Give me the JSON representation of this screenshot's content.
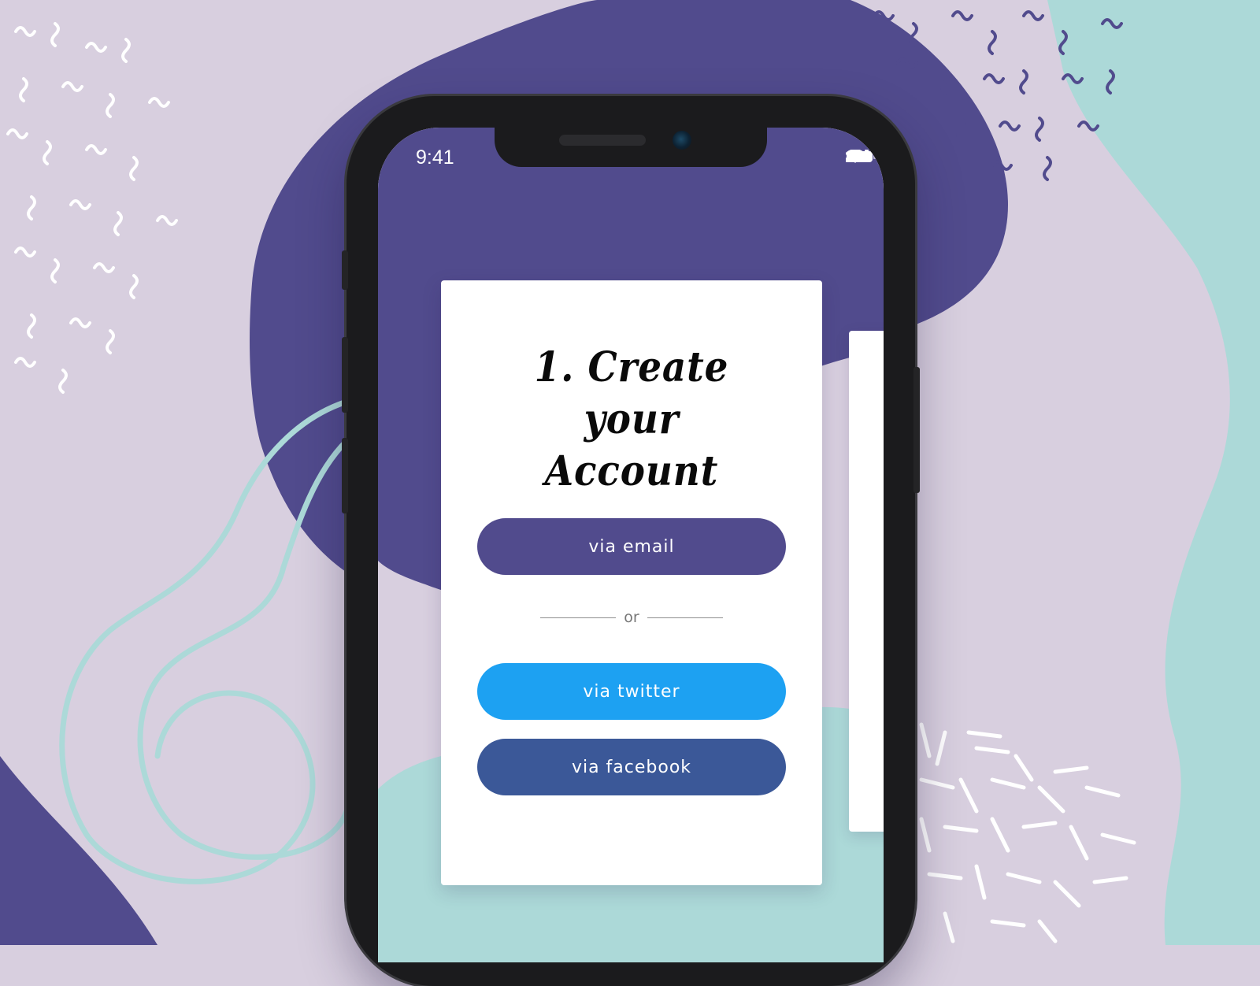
{
  "status_bar": {
    "time": "9:41",
    "icons": [
      "signal-icon",
      "wifi-icon",
      "battery-icon"
    ]
  },
  "card": {
    "title_line1": "1. Create your",
    "title_line2": "Account",
    "email_button": "via email",
    "divider_text": "or",
    "twitter_button": "via twitter",
    "facebook_button": "via facebook"
  },
  "colors": {
    "background": "#d8cfdf",
    "purple_blob": "#514b8d",
    "mint": "#acd9d8",
    "email_button": "#514b8d",
    "twitter_button": "#1da1f2",
    "facebook_button": "#3b5898",
    "card": "#ffffff"
  }
}
